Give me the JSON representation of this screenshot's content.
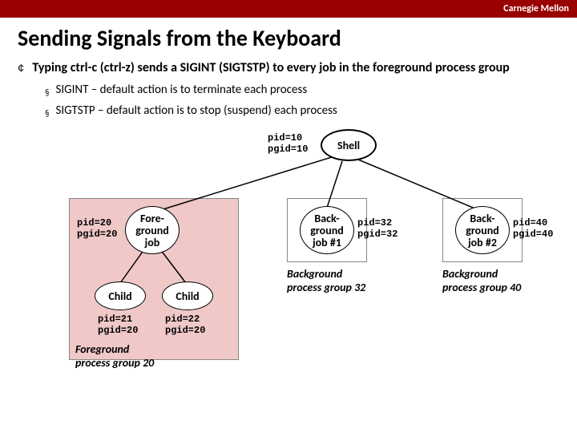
{
  "brand": "Carnegie Mellon",
  "title": "Sending Signals from the Keyboard",
  "bullet1": "Typing ctrl-c (ctrl-z) sends a SIGINT (SIGTSTP) to every job in the foreground process group",
  "sub1": "SIGINT – default action is to terminate each process",
  "sub2": "SIGTSTP – default action is to stop (suspend) each process",
  "shell": {
    "label": "Shell",
    "ids": "pid=10\npgid=10"
  },
  "fg": {
    "label": "Fore-\nground\njob",
    "ids": "pid=20\npgid=20",
    "caption": "Foreground\nprocess group 20"
  },
  "bg1": {
    "label": "Back-\nground\njob #1",
    "ids": "pid=32\npgid=32",
    "caption": "Background\nprocess group 32"
  },
  "bg2": {
    "label": "Back-\nground\njob #2",
    "ids": "pid=40\npgid=40",
    "caption": "Background\nprocess group 40"
  },
  "child1": {
    "label": "Child",
    "ids": "pid=21\npgid=20"
  },
  "child2": {
    "label": "Child",
    "ids": "pid=22\npgid=20"
  }
}
